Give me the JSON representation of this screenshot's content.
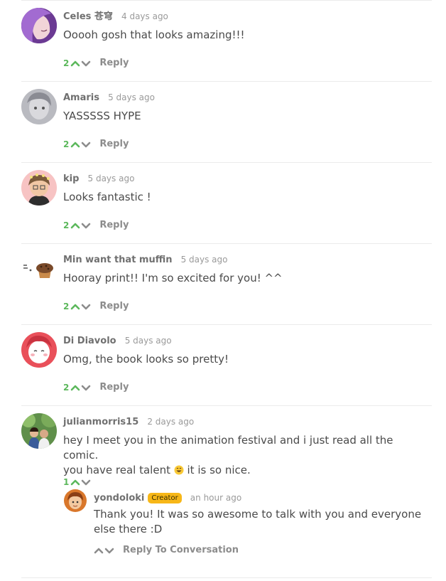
{
  "comments": [
    {
      "author": "Celes 苍穹",
      "time": "4 days ago",
      "text": "Ooooh gosh that looks amazing!!!",
      "votes": "2",
      "reply_label": "Reply"
    },
    {
      "author": "Amaris",
      "time": "5 days ago",
      "text": "YASSSSS HYPE",
      "votes": "2",
      "reply_label": "Reply"
    },
    {
      "author": "kip",
      "time": "5 days ago",
      "text": "Looks fantastic !",
      "votes": "2",
      "reply_label": "Reply"
    },
    {
      "author": "Min want that muffin",
      "time": "5 days ago",
      "text": "Hooray print!! I'm so excited for you! ^^",
      "votes": "2",
      "reply_label": "Reply"
    },
    {
      "author": "Di Diavolo",
      "time": "5 days ago",
      "text": "Omg, the book looks so pretty!",
      "votes": "2",
      "reply_label": "Reply"
    },
    {
      "author": "julianmorris15",
      "time": "2 days ago",
      "text_line1": "hey I meet you in the animation festival and i just read all the comic.",
      "text_line2a": "you have real talent",
      "text_line2b": " it is so nice.",
      "votes": "1"
    }
  ],
  "reply": {
    "author": "yondoloki",
    "badge": "Creator",
    "time": "an hour ago",
    "text": "Thank you! It was so awesome to talk with you and everyone else there :D",
    "reply_label": "Reply To Conversation"
  },
  "colors": {
    "upvote": "#5cb85c",
    "badge": "#f7b718",
    "muted": "#9a9a9a"
  },
  "icons": [
    "upvote-arrow-icon",
    "downvote-arrow-icon",
    "grinning-emoji-icon"
  ]
}
